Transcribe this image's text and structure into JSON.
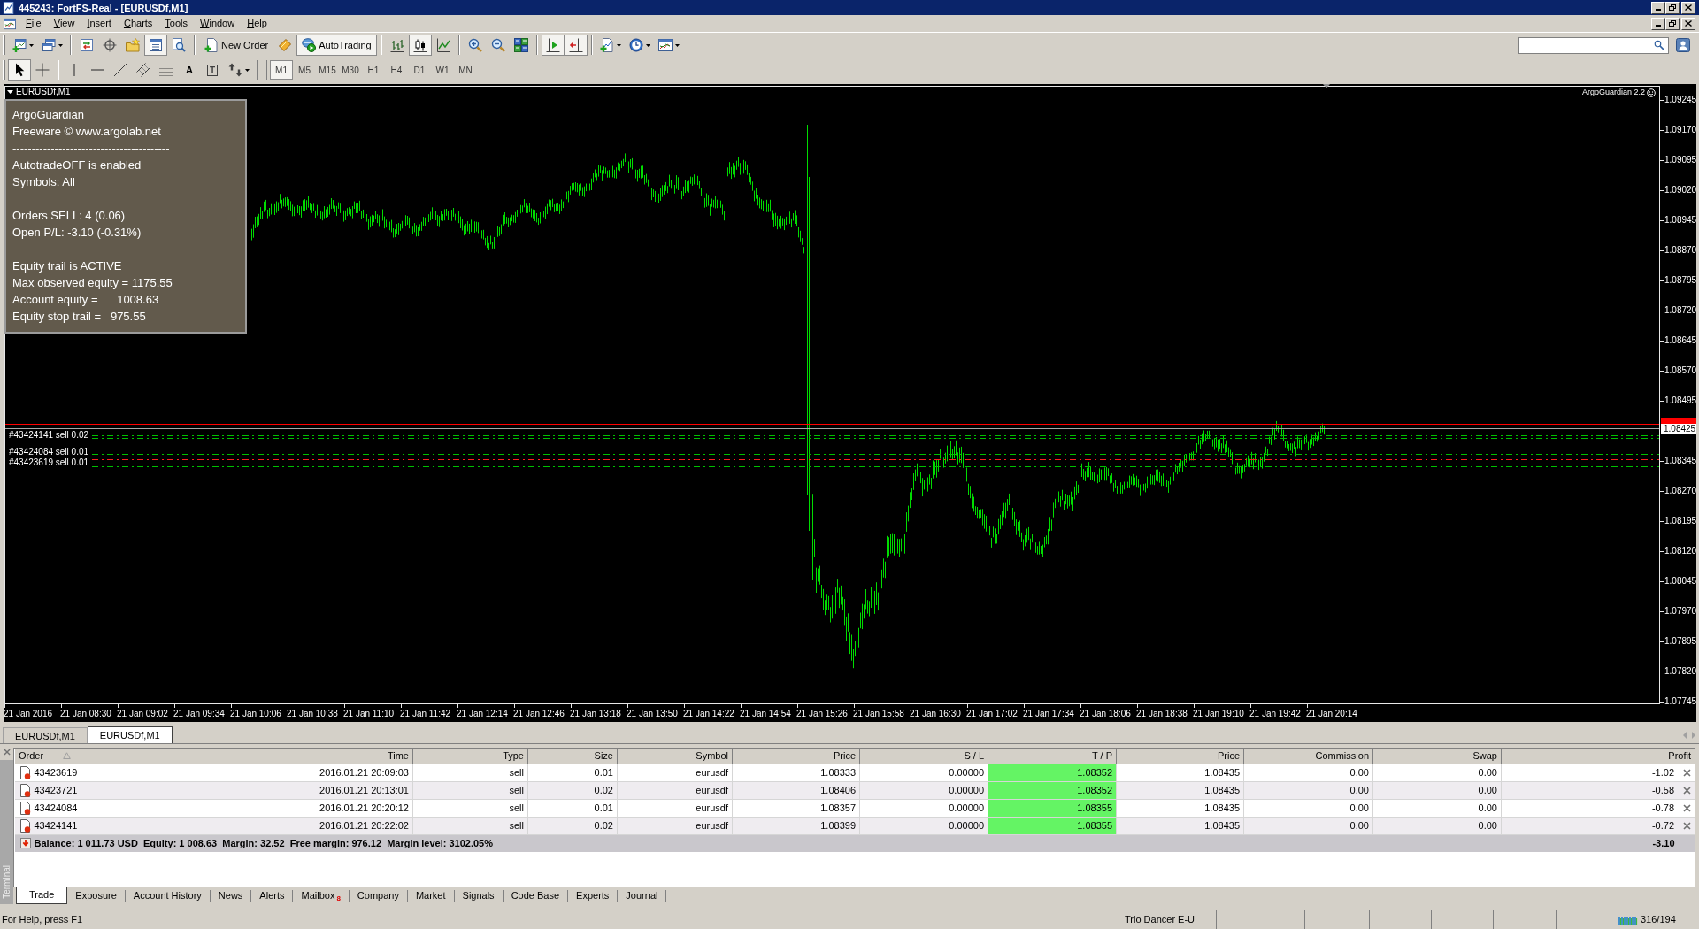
{
  "window": {
    "title": "445243: FortFS-Real - [EURUSDf,M1]"
  },
  "menu": [
    "File",
    "View",
    "Insert",
    "Charts",
    "Tools",
    "Window",
    "Help"
  ],
  "main_toolbar": {
    "groups": [
      [
        {
          "kind": "dropdown",
          "pressed": false
        },
        {
          "kind": "dropdown",
          "pressed": false
        }
      ],
      [
        {
          "kind": "icon",
          "pressed": false
        },
        {
          "kind": "icon",
          "pressed": false
        },
        {
          "kind": "icon",
          "pressed": false
        },
        {
          "kind": "icon",
          "pressed": true
        },
        {
          "kind": "icon",
          "pressed": false
        }
      ],
      [
        {
          "kind": "button",
          "label": "New Order",
          "pressed": false
        },
        {
          "kind": "icon",
          "pressed": false
        },
        {
          "kind": "button",
          "label": "AutoTrading",
          "pressed": true
        }
      ],
      [
        {
          "kind": "icon",
          "pressed": false
        },
        {
          "kind": "icon",
          "pressed": true
        },
        {
          "kind": "icon",
          "pressed": false
        }
      ],
      [
        {
          "kind": "icon",
          "pressed": false
        },
        {
          "kind": "icon",
          "pressed": false
        },
        {
          "kind": "icon",
          "pressed": false
        }
      ],
      [
        {
          "kind": "icon",
          "pressed": true
        },
        {
          "kind": "icon",
          "pressed": true
        }
      ],
      [
        {
          "kind": "dropdown",
          "pressed": false
        },
        {
          "kind": "dropdown",
          "pressed": false
        },
        {
          "kind": "dropdown",
          "pressed": false
        }
      ]
    ]
  },
  "drawing_toolbar": {
    "groups": [
      [
        {
          "kind": "icon",
          "pressed": true
        },
        {
          "kind": "icon",
          "pressed": false
        }
      ],
      [
        {
          "kind": "icon",
          "pressed": false
        },
        {
          "kind": "icon",
          "pressed": false
        },
        {
          "kind": "icon",
          "pressed": false
        },
        {
          "kind": "icon",
          "pressed": false
        },
        {
          "kind": "icon",
          "pressed": false
        },
        {
          "kind": "glyph",
          "glyph": "A",
          "pressed": false
        },
        {
          "kind": "boxed-glyph",
          "glyph": "T",
          "pressed": false
        },
        {
          "kind": "dropdown",
          "pressed": false
        }
      ]
    ]
  },
  "timeframes": [
    {
      "label": "M1",
      "selected": true
    },
    {
      "label": "M5",
      "selected": false
    },
    {
      "label": "M15",
      "selected": false
    },
    {
      "label": "M30",
      "selected": false
    },
    {
      "label": "H1",
      "selected": false
    },
    {
      "label": "H4",
      "selected": false
    },
    {
      "label": "D1",
      "selected": false
    },
    {
      "label": "W1",
      "selected": false
    },
    {
      "label": "MN",
      "selected": false
    }
  ],
  "chart": {
    "title": "EURUSDf,M1",
    "indicator_name": "ArgoGuardian 2.2",
    "info_panel": [
      [
        "ArgoGuardian",
        "Freeware © www.argolab.net",
        "-----------------------------------------",
        "AutotradeOFF is enabled",
        "Symbols: All"
      ],
      [
        "Orders SELL: 4 (0.06)",
        "Open P/L: -3.10 (-0.31%)"
      ],
      [
        "Equity trail is ACTIVE",
        "Max observed equity = 1175.55",
        "Account equity =      1008.63",
        "Equity stop trail =   975.55"
      ]
    ],
    "order_labels": [
      "#43424141 sell 0.02",
      "#43424084 sell 0.01",
      "#43423619 sell 0.01"
    ],
    "price_axis": {
      "upper": [
        "1.09245",
        "1.09170",
        "1.09095",
        "1.09020",
        "1.08945",
        "1.08870",
        "1.08795",
        "1.08720",
        "1.08645",
        "1.08570",
        "1.08495"
      ],
      "current_price": "1.08425",
      "lower": [
        "1.08345",
        "1.08270",
        "1.08195",
        "1.08120",
        "1.08045",
        "1.07970",
        "1.07895",
        "1.07820",
        "1.07745"
      ]
    },
    "time_labels": [
      "21 Jan 2016",
      "21 Jan 08:30",
      "21 Jan 09:02",
      "21 Jan 09:34",
      "21 Jan 10:06",
      "21 Jan 10:38",
      "21 Jan 11:10",
      "21 Jan 11:42",
      "21 Jan 12:14",
      "21 Jan 12:46",
      "21 Jan 13:18",
      "21 Jan 13:50",
      "21 Jan 14:22",
      "21 Jan 14:54",
      "21 Jan 15:26",
      "21 Jan 15:58",
      "21 Jan 16:30",
      "21 Jan 17:02",
      "21 Jan 17:34",
      "21 Jan 18:06",
      "21 Jan 18:38",
      "21 Jan 19:10",
      "21 Jan 19:42",
      "21 Jan 20:14"
    ]
  },
  "chart_tabs": [
    {
      "label": "EURUSDf,M1",
      "selected": false
    },
    {
      "label": "EURUSDf,M1",
      "selected": true
    }
  ],
  "terminal": {
    "title": "Terminal",
    "columns": [
      {
        "label": "Order",
        "sorted": true
      },
      {
        "label": "Time",
        "sorted": false
      },
      {
        "label": "Type",
        "sorted": false
      },
      {
        "label": "Size",
        "sorted": false
      },
      {
        "label": "Symbol",
        "sorted": false
      },
      {
        "label": "Price",
        "sorted": false
      },
      {
        "label": "S / L",
        "sorted": false
      },
      {
        "label": "T / P",
        "sorted": false
      },
      {
        "label": "Price",
        "sorted": false
      },
      {
        "label": "Commission",
        "sorted": false
      },
      {
        "label": "Swap",
        "sorted": false
      },
      {
        "label": "Profit",
        "sorted": false
      }
    ],
    "rows": [
      {
        "cells": [
          "43423619",
          "2016.01.21 20:09:03",
          "sell",
          "0.01",
          "eurusdf",
          "1.08333",
          "0.00000",
          "1.08352",
          "1.08435",
          "0.00",
          "0.00",
          "-1.02"
        ],
        "tp_highlight": true
      },
      {
        "cells": [
          "43423721",
          "2016.01.21 20:13:01",
          "sell",
          "0.02",
          "eurusdf",
          "1.08406",
          "0.00000",
          "1.08352",
          "1.08435",
          "0.00",
          "0.00",
          "-0.58"
        ],
        "tp_highlight": true
      },
      {
        "cells": [
          "43424084",
          "2016.01.21 20:20:12",
          "sell",
          "0.01",
          "eurusdf",
          "1.08357",
          "0.00000",
          "1.08355",
          "1.08435",
          "0.00",
          "0.00",
          "-0.78"
        ],
        "tp_highlight": true
      },
      {
        "cells": [
          "43424141",
          "2016.01.21 20:22:02",
          "sell",
          "0.02",
          "eurusdf",
          "1.08399",
          "0.00000",
          "1.08355",
          "1.08435",
          "0.00",
          "0.00",
          "-0.72"
        ],
        "tp_highlight": true
      }
    ],
    "summary": {
      "text": "Balance: 1 011.73 USD  Equity: 1 008.63  Margin: 32.52  Free margin: 976.12  Margin level: 3102.05%",
      "profit": "-3.10"
    },
    "tabs": [
      {
        "label": "Trade",
        "selected": true
      },
      {
        "label": "Exposure",
        "selected": false
      },
      {
        "label": "Account History",
        "selected": false
      },
      {
        "label": "News",
        "selected": false
      },
      {
        "label": "Alerts",
        "selected": false
      },
      {
        "label": "Mailbox",
        "selected": false,
        "badge": "8"
      },
      {
        "label": "Company",
        "selected": false
      },
      {
        "label": "Market",
        "selected": false
      },
      {
        "label": "Signals",
        "selected": false
      },
      {
        "label": "Code Base",
        "selected": false
      },
      {
        "label": "Experts",
        "selected": false
      },
      {
        "label": "Journal",
        "selected": false
      }
    ]
  },
  "status_bar": {
    "help": "For Help, press F1",
    "profile": "Trio Dancer E-U",
    "connection": "316/194"
  }
}
